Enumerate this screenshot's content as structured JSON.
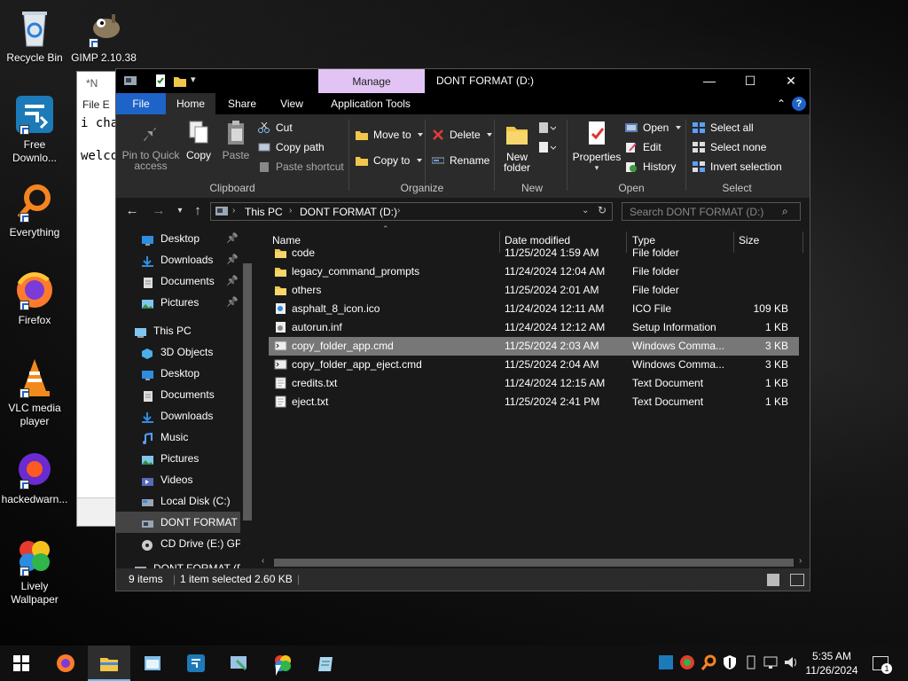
{
  "desktop": {
    "icons": [
      {
        "label": "Recycle Bin"
      },
      {
        "label": "GIMP 2.10.38"
      },
      {
        "label": "Free Downlo..."
      },
      {
        "label": "Everything"
      },
      {
        "label": "Firefox"
      },
      {
        "label": "VLC media player"
      },
      {
        "label": "hackedwarn..."
      },
      {
        "label": "Lively Wallpaper"
      }
    ]
  },
  "notepad": {
    "title": "*N",
    "menu": "File  E",
    "line1": "i cha",
    "line2": "welco"
  },
  "explorer": {
    "manage_label": "Manage",
    "title": "DONT FORMAT (D:)",
    "controls": {
      "minimize": "—",
      "maximize": "☐",
      "close": "✕"
    },
    "tabs": [
      "File",
      "Home",
      "Share",
      "View",
      "Application Tools"
    ],
    "ribbon": {
      "clipboard": {
        "pin": "Pin to Quick access",
        "copy": "Copy",
        "paste": "Paste",
        "cut": "Cut",
        "copy_path": "Copy path",
        "paste_shortcut": "Paste shortcut",
        "label": "Clipboard"
      },
      "organize": {
        "move_to": "Move to",
        "copy_to": "Copy to",
        "delete": "Delete",
        "rename": "Rename",
        "label": "Organize"
      },
      "new": {
        "new_folder": "New folder",
        "label": "New"
      },
      "open": {
        "properties": "Properties",
        "open": "Open",
        "edit": "Edit",
        "history": "History",
        "label": "Open"
      },
      "select": {
        "select_all": "Select all",
        "select_none": "Select none",
        "invert": "Invert selection",
        "label": "Select"
      }
    },
    "address": {
      "crumbs": [
        "This PC",
        "DONT FORMAT (D:)"
      ],
      "search_placeholder": "Search DONT FORMAT (D:)"
    },
    "nav": [
      {
        "label": "Desktop",
        "pinned": true
      },
      {
        "label": "Downloads",
        "pinned": true
      },
      {
        "label": "Documents",
        "pinned": true
      },
      {
        "label": "Pictures",
        "pinned": true
      },
      {
        "label": "This PC"
      },
      {
        "label": "3D Objects"
      },
      {
        "label": "Desktop"
      },
      {
        "label": "Documents"
      },
      {
        "label": "Downloads"
      },
      {
        "label": "Music"
      },
      {
        "label": "Pictures"
      },
      {
        "label": "Videos"
      },
      {
        "label": "Local Disk (C:)"
      },
      {
        "label": "DONT FORMAT (D:)"
      },
      {
        "label": "CD Drive (E:) GParted-live"
      },
      {
        "label": "DONT FORMAT (D:)"
      }
    ],
    "columns": {
      "name": "Name",
      "date": "Date modified",
      "type": "Type",
      "size": "Size"
    },
    "files": [
      {
        "name": "code",
        "date": "11/25/2024 1:59 AM",
        "type": "File folder",
        "size": "",
        "kind": "folder"
      },
      {
        "name": "legacy_command_prompts",
        "date": "11/24/2024 12:04 AM",
        "type": "File folder",
        "size": "",
        "kind": "folder"
      },
      {
        "name": "others",
        "date": "11/25/2024 2:01 AM",
        "type": "File folder",
        "size": "",
        "kind": "folder"
      },
      {
        "name": "asphalt_8_icon.ico",
        "date": "11/24/2024 12:11 AM",
        "type": "ICO File",
        "size": "109 KB",
        "kind": "ico"
      },
      {
        "name": "autorun.inf",
        "date": "11/24/2024 12:12 AM",
        "type": "Setup Information",
        "size": "1 KB",
        "kind": "inf"
      },
      {
        "name": "copy_folder_app.cmd",
        "date": "11/25/2024 2:03 AM",
        "type": "Windows Comma...",
        "size": "3 KB",
        "kind": "cmd",
        "selected": true
      },
      {
        "name": "copy_folder_app_eject.cmd",
        "date": "11/25/2024 2:04 AM",
        "type": "Windows Comma...",
        "size": "3 KB",
        "kind": "cmd"
      },
      {
        "name": "credits.txt",
        "date": "11/24/2024 12:15 AM",
        "type": "Text Document",
        "size": "1 KB",
        "kind": "txt"
      },
      {
        "name": "eject.txt",
        "date": "11/25/2024 2:41 PM",
        "type": "Text Document",
        "size": "1 KB",
        "kind": "txt"
      }
    ],
    "status": {
      "count": "9 items",
      "selected": "1 item selected  2.60 KB"
    }
  },
  "taskbar": {
    "time": "5:35 AM",
    "date": "11/26/2024",
    "notification_count": "1"
  }
}
